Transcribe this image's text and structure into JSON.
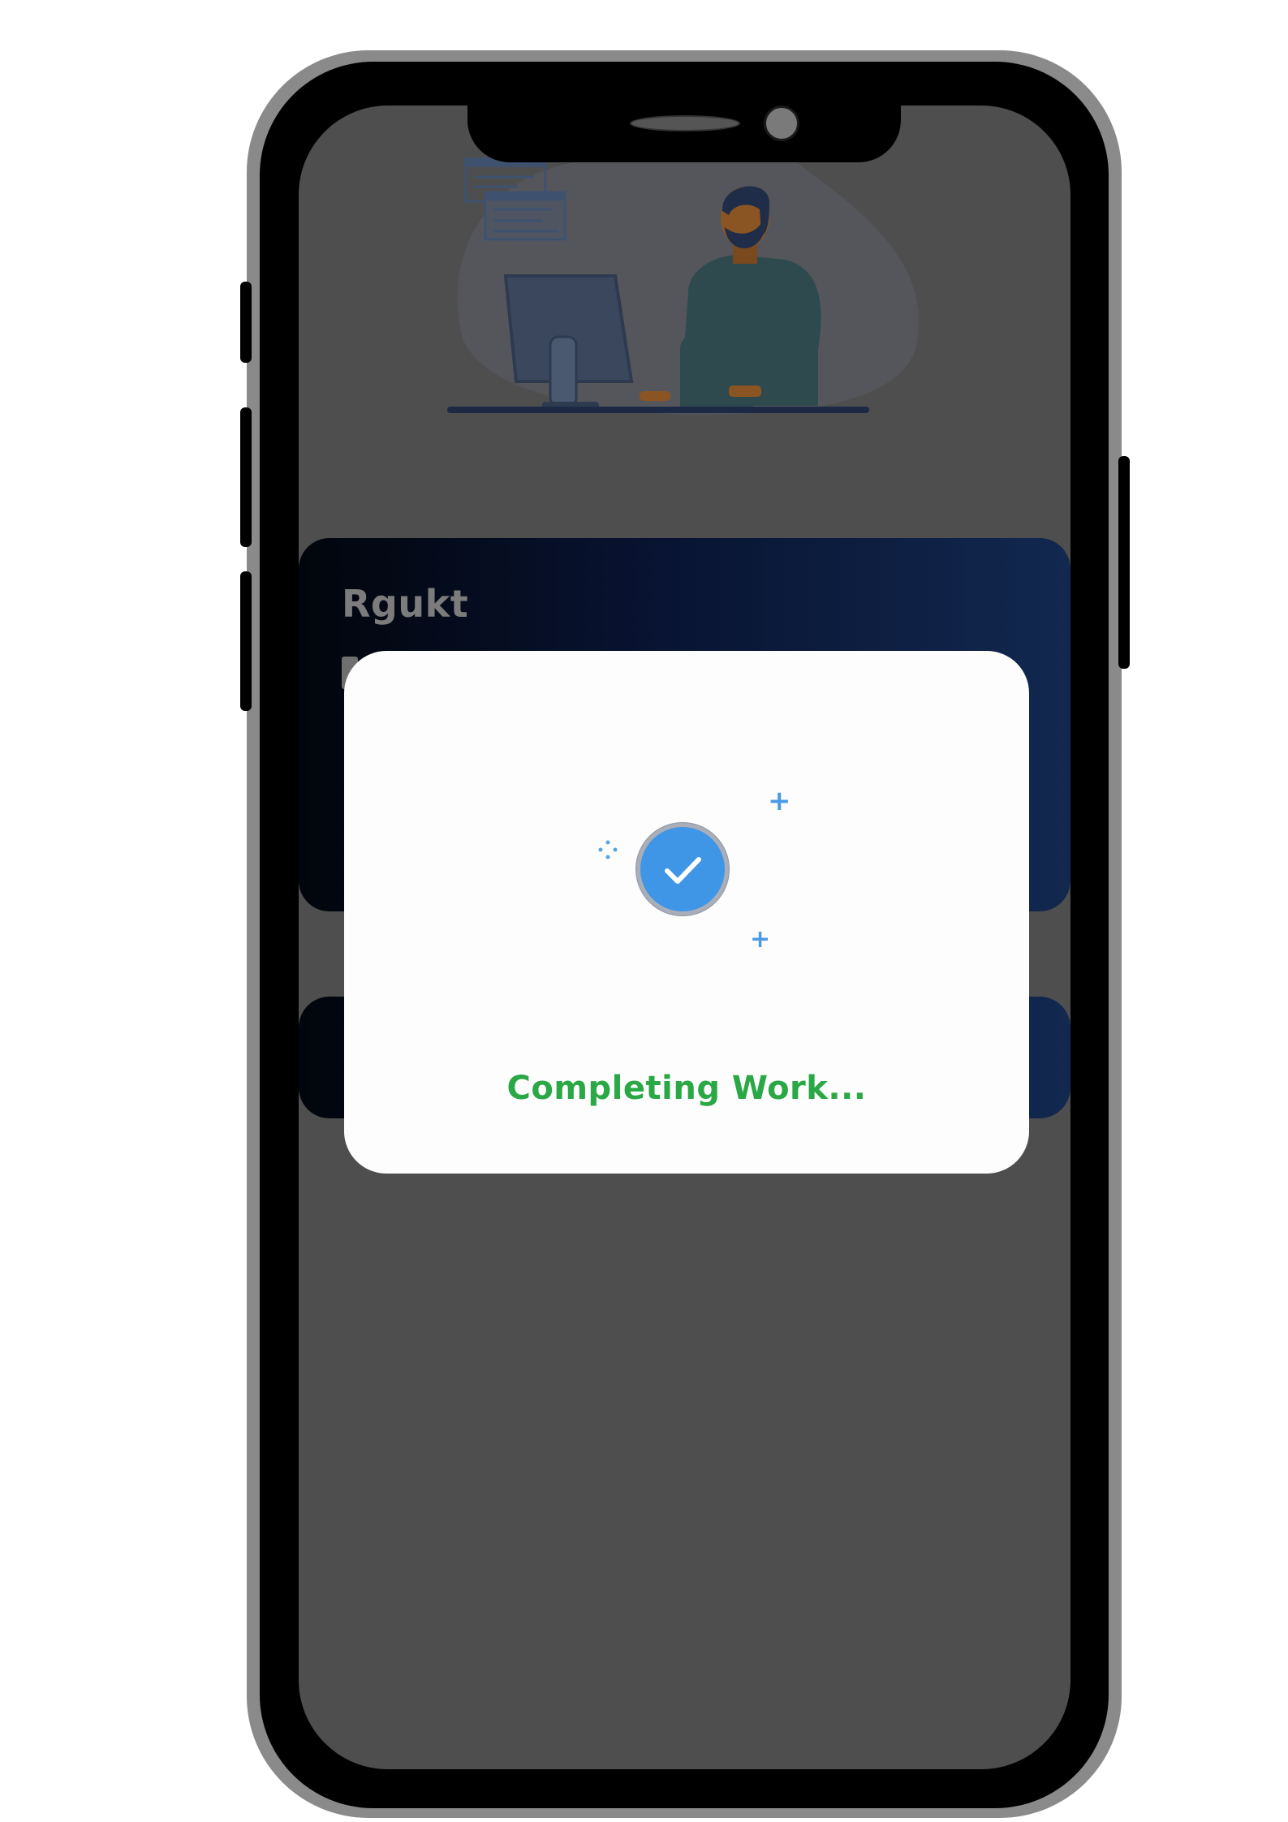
{
  "app": {
    "card_title": "Rgukt"
  },
  "dialog": {
    "status_text": "Completing Work...",
    "icon": "check-circle-icon"
  },
  "colors": {
    "screen_bg": "#4e4e4e",
    "card_gradient_start": "#02050c",
    "card_gradient_end": "#12284f",
    "status_text": "#2aa845",
    "check_fill": "#3f95e6"
  }
}
